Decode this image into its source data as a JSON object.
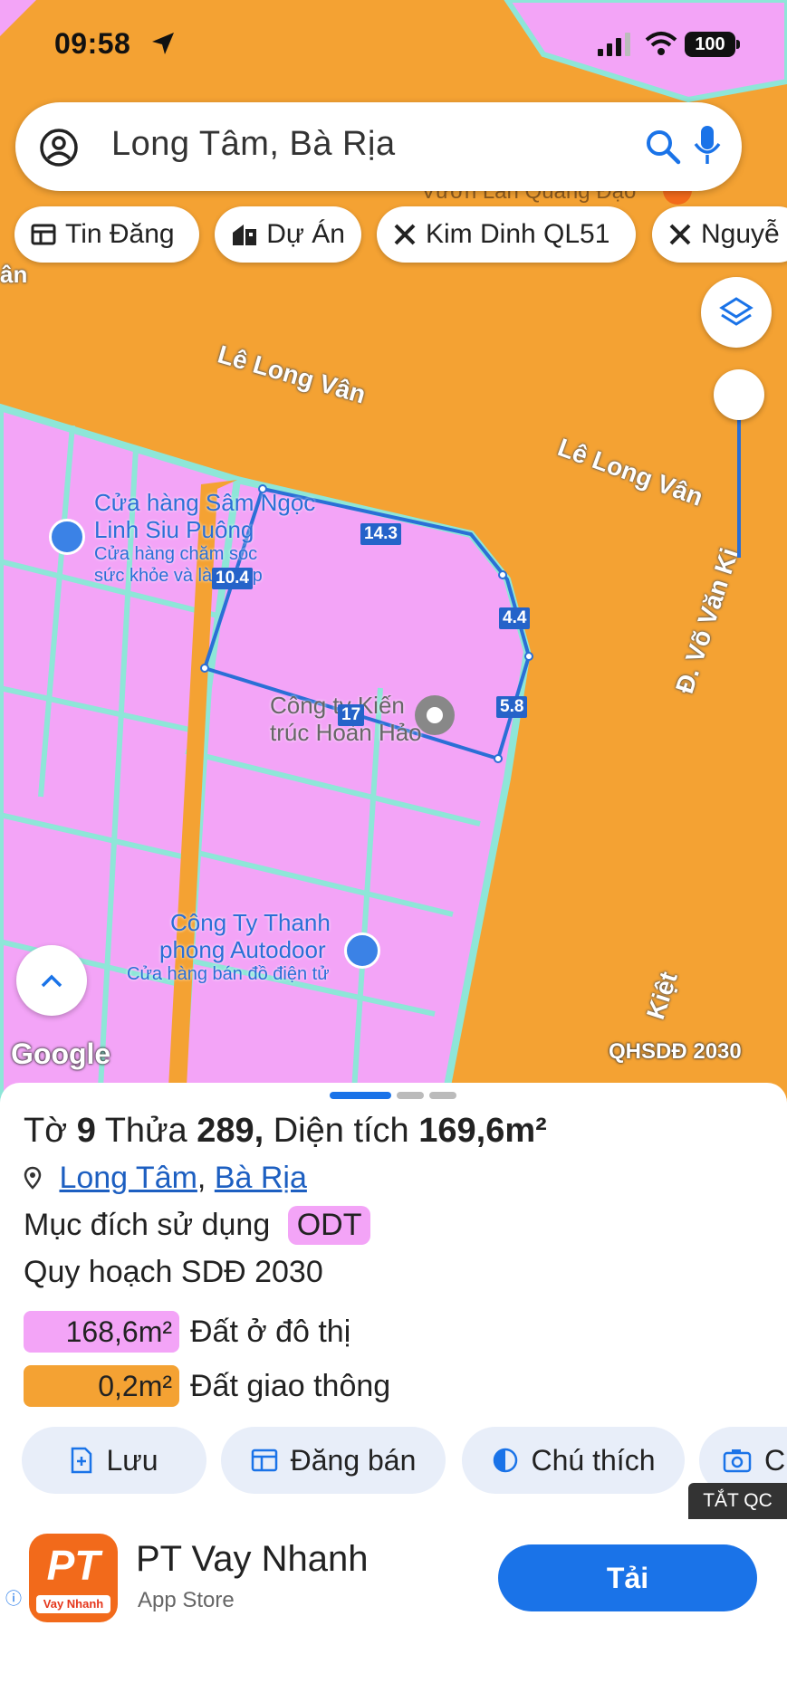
{
  "status_bar": {
    "time": "09:58",
    "battery": "100"
  },
  "search": {
    "query": "Long Tâm, Bà Rịa"
  },
  "chips": [
    {
      "label": "Tin Đăng",
      "icon": "news-icon"
    },
    {
      "label": "Dự Án",
      "icon": "building-icon"
    },
    {
      "label": "Kim Dinh QL51",
      "icon": "tools-icon"
    },
    {
      "label": "Nguyễ",
      "icon": "tools-icon"
    }
  ],
  "map": {
    "streets": [
      "Lê Long Vân",
      "Lê Long Vân",
      "Đ. Võ Văn Ki",
      "ân",
      "Kiệt",
      "Vườn Lan Quang Đạo"
    ],
    "pois": [
      {
        "title": "Cửa hàng Sâm Ngọc Linh Siu Puông",
        "title_line1": "Cửa hàng Sâm Ngọc",
        "title_line2": "Linh Siu Puông",
        "sub_line1": "Cửa hàng chăm sóc",
        "sub_line2": "sức khỏe và làm đẹp"
      },
      {
        "title_line1": "Công ty Kiến",
        "title_line2": "trúc Hoàn Hảo"
      },
      {
        "title_line1": "Công Ty Thanh",
        "title_line2": "phong Autodoor",
        "sub_line1": "Cửa hàng bán đồ điện tử"
      }
    ],
    "dimensions": [
      "14.3",
      "10.4",
      "4.4",
      "5.8",
      "17"
    ],
    "attribution": "Google",
    "layer_label": "QHSDĐ 2030",
    "colors": {
      "urban_land": "#f3a4f7",
      "traffic_land": "#f4a233",
      "boundary": "#2a6fd6"
    }
  },
  "parcel": {
    "to_label": "Tờ",
    "to_value": "9",
    "thua_label": "Thửa",
    "thua_value": "289,",
    "area_label": "Diện tích",
    "area_value": "169,6m²",
    "ward": "Long Tâm",
    "city": "Bà Rịa",
    "purpose_label": "Mục đích sử dụng",
    "purpose_code": "ODT",
    "plan_label": "Quy hoạch SDĐ 2030",
    "areas": [
      {
        "value": "168,6m²",
        "label": "Đất ở đô thị",
        "color": "#f3a4f7"
      },
      {
        "value": "0,2m²",
        "label": "Đất giao thông",
        "color": "#f4a233"
      }
    ]
  },
  "actions": [
    {
      "label": "Lưu",
      "icon": "save-icon"
    },
    {
      "label": "Đăng bán",
      "icon": "post-icon"
    },
    {
      "label": "Chú thích",
      "icon": "legend-icon"
    },
    {
      "label": "C",
      "icon": "camera-icon"
    }
  ],
  "ad": {
    "hide_label": "TẮT QC",
    "logo_text": "PT",
    "logo_sub": "Vay Nhanh",
    "title": "PT Vay Nhanh",
    "subtitle": "App Store",
    "cta": "Tải"
  }
}
